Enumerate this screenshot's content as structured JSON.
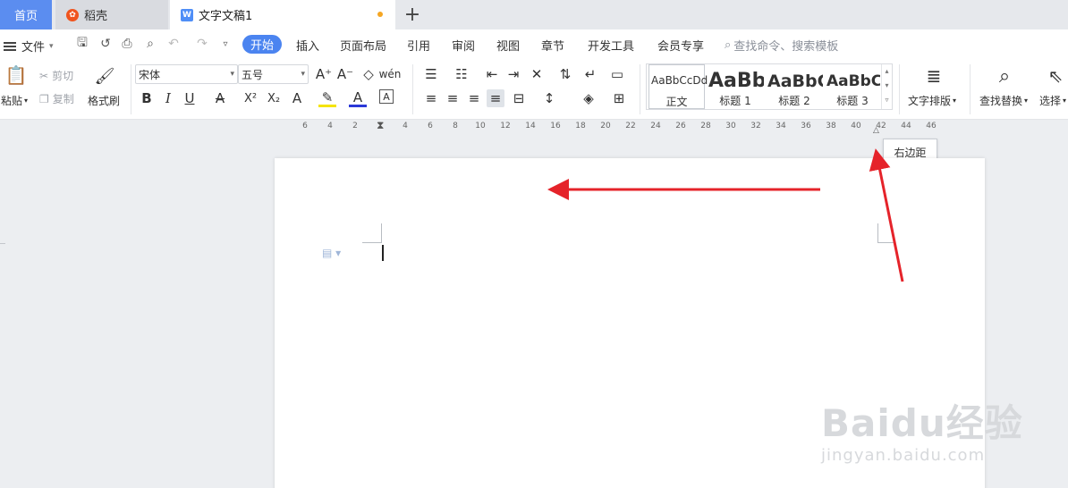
{
  "tabs": {
    "home": "首页",
    "daoke": "稻壳",
    "document": "文字文稿1"
  },
  "menu": {
    "file": "文件",
    "items": [
      "开始",
      "插入",
      "页面布局",
      "引用",
      "审阅",
      "视图",
      "章节",
      "开发工具",
      "会员专享"
    ],
    "search_placeholder": "查找命令、搜索模板"
  },
  "ribbon": {
    "paste": "粘贴",
    "cut": "剪切",
    "copy": "复制",
    "format_painter": "格式刷",
    "font_name": "宋体",
    "font_size": "五号",
    "styles": [
      {
        "sample": "AaBbCcDd",
        "name": "正文"
      },
      {
        "sample": "AaBb",
        "name": "标题 1"
      },
      {
        "sample": "AaBbC",
        "name": "标题 2"
      },
      {
        "sample": "AaBbC",
        "name": "标题 3"
      }
    ],
    "text_layout": "文字排版",
    "find_replace": "查找替换",
    "select": "选择"
  },
  "ruler_ticks": [
    "6",
    "4",
    "2",
    "2",
    "4",
    "6",
    "8",
    "10",
    "12",
    "14",
    "16",
    "18",
    "20",
    "22",
    "24",
    "26",
    "28",
    "30",
    "32",
    "34",
    "36",
    "38",
    "40",
    "42",
    "44",
    "46"
  ],
  "tooltip": "右边距",
  "watermark": {
    "line1": "Baidu经验",
    "line2": "jingyan.baidu.com"
  },
  "colors": {
    "accent": "#4b84f0",
    "arrow": "#e5232a",
    "tab_home": "#5b8df0"
  }
}
